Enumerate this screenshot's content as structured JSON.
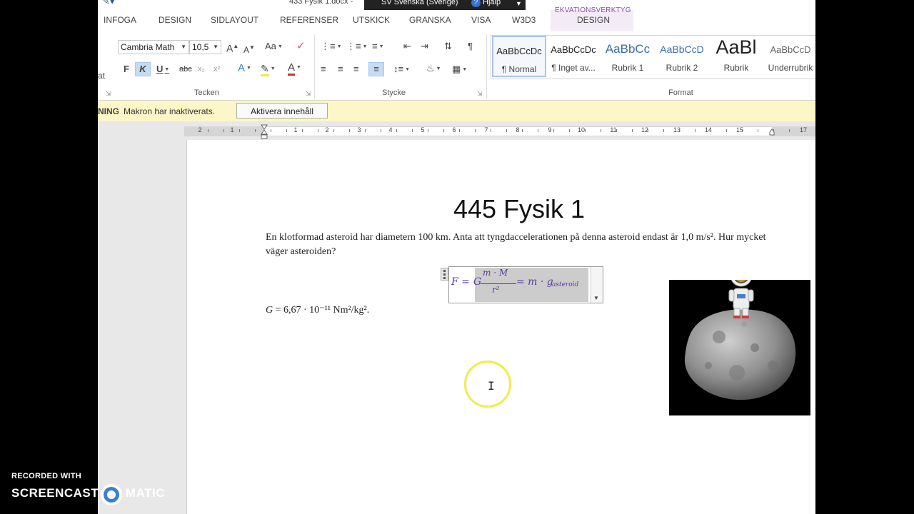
{
  "titlebar": {
    "doc_title": "433 Fysik 1.docx -",
    "language": "SV Svenska (Sverige)",
    "help": "Hjälp",
    "help_icon": "?"
  },
  "tabs": {
    "items": [
      "INFOGA",
      "DESIGN",
      "SIDLAYOUT",
      "REFERENSER",
      "UTSKICK",
      "GRANSKA",
      "VISA",
      "W3D3",
      "DESIGN"
    ],
    "context_group": "EKVATIONSVERKTYG",
    "context_color": "#8a4fa8"
  },
  "ribbon": {
    "font_name": "Cambria Math",
    "font_size": "10,5",
    "grow_font": "A",
    "shrink_font": "A",
    "change_case": "Aa",
    "bold": "F",
    "italic": "K",
    "underline": "U",
    "strike": "abc",
    "subscript": "x₂",
    "superscript": "x²",
    "text_effects": "A",
    "font_color": "A",
    "partial_left_label": "at",
    "groups": {
      "font": "Tecken",
      "paragraph": "Stycke",
      "styles": "Format"
    },
    "styles": [
      {
        "sample": "AaBbCcDc",
        "name": "¶ Normal"
      },
      {
        "sample": "AaBbCcDc",
        "name": "¶ Inget av..."
      },
      {
        "sample": "AaBbCc",
        "name": "Rubrik 1"
      },
      {
        "sample": "AaBbCcD",
        "name": "Rubrik 2"
      },
      {
        "sample": "AaBl",
        "name": "Rubrik"
      },
      {
        "sample": "AaBbCcD",
        "name": "Underrubrik"
      }
    ]
  },
  "message_bar": {
    "warning_label": "NING",
    "text": "Makron har inaktiverats.",
    "button": "Aktivera innehåll"
  },
  "ruler": {
    "numbers": [
      "2",
      "1",
      "1",
      "2",
      "3",
      "4",
      "5",
      "6",
      "7",
      "8",
      "9",
      "10",
      "11",
      "12",
      "13",
      "14",
      "15",
      "17"
    ]
  },
  "document": {
    "heading": "445 Fysik 1",
    "paragraph": "En klotformad asteroid har diametern 100 km. Anta att tyngdaccelerationen på denna asteroid endast är 1,0 m/s². Hur mycket väger asteroiden?",
    "g_label": "G",
    "g_value": " = 6,67 · 10⁻¹¹ Nm²/kg².",
    "equation": {
      "lhs": "F =",
      "coef": "G",
      "numerator": "m · M",
      "denominator": "r²",
      "rhs": "= m · g",
      "subscript": "asteroid"
    },
    "image_alt": "astronaut on asteroid"
  },
  "watermark": {
    "line1": "RECORDED WITH",
    "line2a": "SCREENCAST",
    "line2b": "MATIC"
  }
}
